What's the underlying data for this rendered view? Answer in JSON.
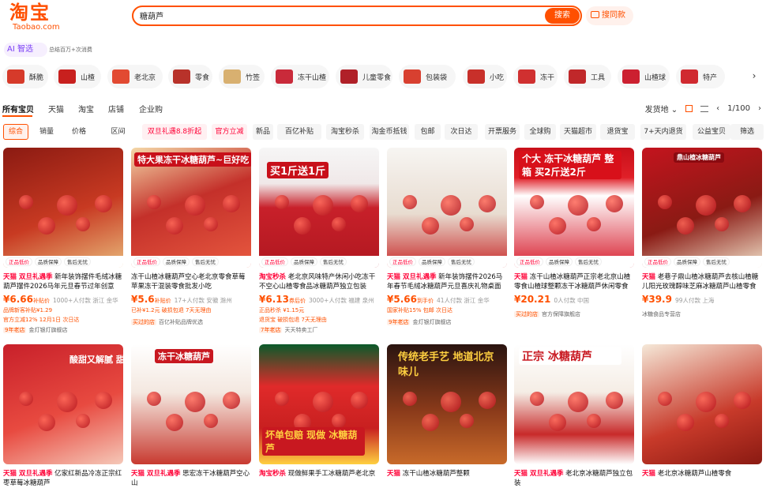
{
  "header": {
    "logo_cn": "淘宝",
    "logo_en": "Taobao.com",
    "search_value": "糖葫芦",
    "search_button": "搜索",
    "photo_search": "搜同款",
    "ai_label": "AI 智选",
    "ai_sub": "总结百万+次消费"
  },
  "categories": [
    "酥脆",
    "山楂",
    "老北京",
    "零食",
    "竹签",
    "冻干山楂",
    "儿童零食",
    "包装袋",
    "小吃",
    "冻干",
    "工具",
    "山楂球",
    "特产"
  ],
  "tabs": [
    "所有宝贝",
    "天猫",
    "淘宝",
    "店铺",
    "企业购"
  ],
  "right_controls": {
    "ship_from": "发货地",
    "page": "1/100"
  },
  "filters": [
    "综合",
    "销量",
    "价格",
    "区间",
    "双旦礼遇8.8折起",
    "官方立减",
    "新品",
    "百亿补贴",
    "淘宝秒杀",
    "淘金币抵钱",
    "包邮",
    "次日达",
    "开票服务",
    "全球购",
    "天猫超市",
    "退货宝",
    "7+天内退货",
    "公益宝贝",
    "筛选"
  ],
  "colors": {
    "brand": "#ff5000",
    "price": "#ff5000",
    "tmall": "#ff0036"
  },
  "products": [
    {
      "tag": "天猫 双旦礼遇季",
      "title": "新年装饰摆件毛绒冰糖葫芦摆件2026马年元旦春节过年创意桌...",
      "price": "¥6.66",
      "inter": "补贴价",
      "sales": "1000+人付款 浙江 金华",
      "line3": "品牌新客补贴¥1.29",
      "shop": "官方立减12% 12月1日 次日达",
      "year": "9年老店",
      "shopname": "金灯银灯旗舰店",
      "overlay": ""
    },
    {
      "tag": "",
      "title": "冻干山楂冰糖葫芦空心老北京零食草莓苹果冻干混装零食批发小吃",
      "price": "¥5.6",
      "inter": "补贴价",
      "sales": "17+人付款 安徽 滁州",
      "line3": "已补¥1.2元 破损包退 7天无理由",
      "shop": "",
      "year": "买过的店",
      "shopname": "百亿补贴品牌优选",
      "overlay": "特大果冻干冰糖葫芦~巨好吃"
    },
    {
      "tag": "淘宝秒杀",
      "title": "老北京风味特产休闲小吃冻干不空心山楂零食品冰糖葫芦独立包装",
      "price": "¥6.13",
      "inter": "券后价",
      "sales": "3000+人付款 福建 泉州",
      "line3": "正品秒杀 ¥1.15元",
      "shop": "退货宝 破损包退 7天无理由",
      "year": "7年老店",
      "shopname": "天天特卖工厂",
      "overlay": "买1斤送1斤"
    },
    {
      "tag": "天猫 双旦礼遇季",
      "title": "新年装饰摆件2026马年春节毛绒冰糖葫芦元旦喜庆礼物桌面摆件...",
      "price": "¥5.66",
      "inter": "到手价",
      "sales": "41人付款 浙江 金华",
      "line3": "国家补贴15% 包邮 次日达",
      "shop": "",
      "year": "9年老店",
      "shopname": "金灯银灯旗舰店",
      "overlay": ""
    },
    {
      "tag": "天猫",
      "title": "冻干山楂冰糖葫芦正宗老北京山楂零食山楂球整颗冻干冰糖葫芦休闲零食品小吃",
      "price": "¥20.21",
      "inter": "",
      "sales": "0人付款 中国",
      "line3": "",
      "shop": "",
      "year": "买过的店",
      "shopname": "官方保障旗舰店",
      "overlay": "个大 冻干冰糖葫芦 整箱 买2斤送2斤"
    },
    {
      "tag": "天猫",
      "title": "老巷子鼎山楂冰糖葫芦去核山楂糖儿阳光玫瑰醇味芝麻冰糖葫芦山楂零食",
      "price": "¥39.9",
      "inter": "",
      "sales": "99人付款 上海",
      "line3": "",
      "shop": "",
      "year": "",
      "shopname": "冰糖食品专营店",
      "overlay": "鼎山楂冰糖葫芦"
    },
    {
      "tag": "天猫 双旦礼遇季",
      "title": "亿家红新品冷冻正宗红枣草莓冰糖葫芦",
      "price": "",
      "inter": "",
      "sales": "",
      "line3": "",
      "shop": "",
      "year": "",
      "shopname": "",
      "overlay": "酸甜又解腻 甜蜜草莓"
    },
    {
      "tag": "天猫 双旦礼遇季",
      "title": "思宏冻干冰糖葫芦空心山",
      "price": "",
      "inter": "",
      "sales": "",
      "line3": "",
      "shop": "",
      "year": "",
      "shopname": "",
      "overlay": "冻干冰糖葫芦"
    },
    {
      "tag": "淘宝秒杀",
      "title": "现做鲜果手工冰糖葫芦老北京",
      "price": "",
      "inter": "",
      "sales": "",
      "line3": "",
      "shop": "",
      "year": "",
      "shopname": "",
      "overlay": "坏单包赔 现做 冰糖葫芦"
    },
    {
      "tag": "天猫",
      "title": "冻干山楂冰糖葫芦整颗",
      "price": "",
      "inter": "",
      "sales": "",
      "line3": "",
      "shop": "",
      "year": "",
      "shopname": "",
      "overlay": "传统老手艺 地道北京味儿"
    },
    {
      "tag": "天猫 双旦礼遇季",
      "title": "老北京冰糖葫芦独立包装",
      "price": "",
      "inter": "",
      "sales": "",
      "line3": "",
      "shop": "",
      "year": "",
      "shopname": "",
      "overlay": "正宗 冰糖葫芦"
    },
    {
      "tag": "天猫",
      "title": "老北京冰糖葫芦山楂零食",
      "price": "",
      "inter": "",
      "sales": "",
      "line3": "",
      "shop": "",
      "year": "",
      "shopname": "",
      "overlay": ""
    }
  ]
}
